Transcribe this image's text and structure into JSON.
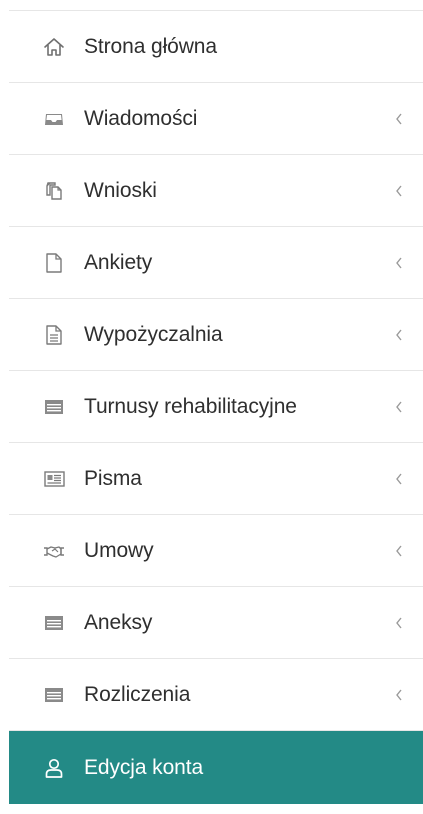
{
  "menu": {
    "items": [
      {
        "label": "Strona główna",
        "icon": "home-icon",
        "has_submenu": false
      },
      {
        "label": "Wiadomości",
        "icon": "inbox-icon",
        "has_submenu": true
      },
      {
        "label": "Wnioski",
        "icon": "copy-documents-icon",
        "has_submenu": true
      },
      {
        "label": "Ankiety",
        "icon": "blank-file-icon",
        "has_submenu": true
      },
      {
        "label": "Wypożyczalnia",
        "icon": "text-file-icon",
        "has_submenu": true
      },
      {
        "label": "Turnusy rehabilitacyjne",
        "icon": "list-icon",
        "has_submenu": true
      },
      {
        "label": "Pisma",
        "icon": "newspaper-icon",
        "has_submenu": true
      },
      {
        "label": "Umowy",
        "icon": "handshake-icon",
        "has_submenu": true
      },
      {
        "label": "Aneksy",
        "icon": "list-icon",
        "has_submenu": true
      },
      {
        "label": "Rozliczenia",
        "icon": "list-icon",
        "has_submenu": true
      },
      {
        "label": "Edycja konta",
        "icon": "user-icon",
        "has_submenu": false,
        "active": true
      }
    ]
  },
  "colors": {
    "active_background": "#238a86",
    "active_text": "#ffffff",
    "text": "#2f2f2f",
    "icon": "#8a8a8a",
    "separator": "#e6e6e6"
  }
}
